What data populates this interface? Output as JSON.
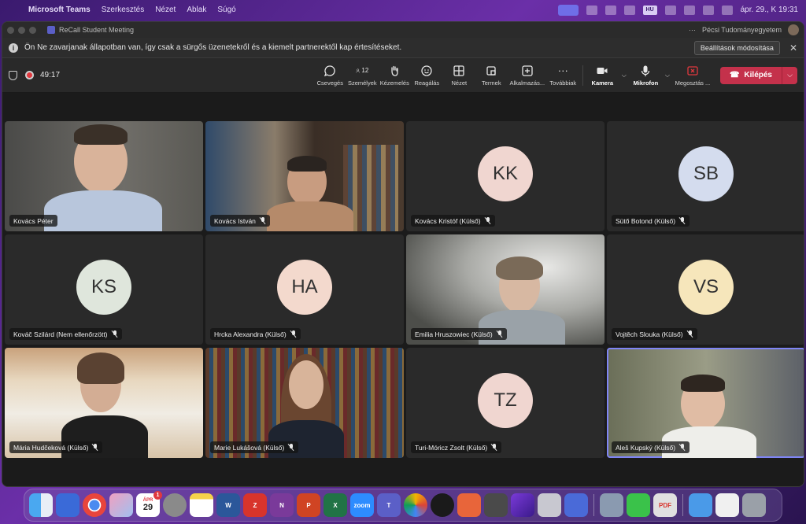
{
  "menubar": {
    "app_name": "Microsoft Teams",
    "items": [
      "Szerkesztés",
      "Nézet",
      "Ablak",
      "Súgó"
    ],
    "keyboard_layout": "HU",
    "datetime": "ápr. 29., K 19:31"
  },
  "window": {
    "title": "ReCall Student Meeting",
    "more": "···",
    "org": "Pécsi Tudományegyetem"
  },
  "notice": {
    "text": "Ön Ne zavarjanak állapotban van, így csak a sürgős üzenetekről és a kiemelt partnerektől kap értesítéseket.",
    "button": "Beállítások módosítása"
  },
  "toolbar": {
    "timer": "49:17",
    "people_count": "12",
    "tools": {
      "chat": "Csevegés",
      "people": "Személyek",
      "raise": "Kézemelés",
      "react": "Reagálás",
      "view": "Nézet",
      "rooms": "Termek",
      "apps": "Alkalmazás...",
      "more": "Továbbiak",
      "camera": "Kamera",
      "mic": "Mikrofon",
      "share": "Megosztás ..."
    },
    "leave": "Kilépés"
  },
  "participants": [
    {
      "name": "Kovács Péter",
      "initials": "",
      "muted": false
    },
    {
      "name": "Kovács István",
      "initials": "",
      "muted": true
    },
    {
      "name": "Kovács Kristóf (Külső)",
      "initials": "KK",
      "muted": true,
      "color": "#f0d6d0"
    },
    {
      "name": "Sütő Botond (Külső)",
      "initials": "SB",
      "muted": true,
      "color": "#d4dcee"
    },
    {
      "name": "Kováč Szilárd (Nem ellenőrzött)",
      "initials": "KS",
      "muted": true,
      "color": "#dfe6dc"
    },
    {
      "name": "Hrcka Alexandra (Külső)",
      "initials": "HA",
      "muted": true,
      "color": "#f3d9cd"
    },
    {
      "name": "Emilia Hruszowiec (Külső)",
      "initials": "",
      "muted": true
    },
    {
      "name": "Vojtěch Slouka (Külső)",
      "initials": "VS",
      "muted": true,
      "color": "#f6e6bb"
    },
    {
      "name": "Mária Hudčeková (Külső)",
      "initials": "",
      "muted": true
    },
    {
      "name": "Marie Lukášová (Külső)",
      "initials": "",
      "muted": true
    },
    {
      "name": "Turi-Móricz Zsolt (Külső)",
      "initials": "TZ",
      "muted": true,
      "color": "#f0d6d0"
    },
    {
      "name": "Aleš Kupský (Külső)",
      "initials": "",
      "muted": true
    }
  ],
  "dock": {
    "calendar_month": "ÁPR",
    "calendar_day": "29",
    "calendar_badge": "1",
    "zoom": "zoom"
  }
}
